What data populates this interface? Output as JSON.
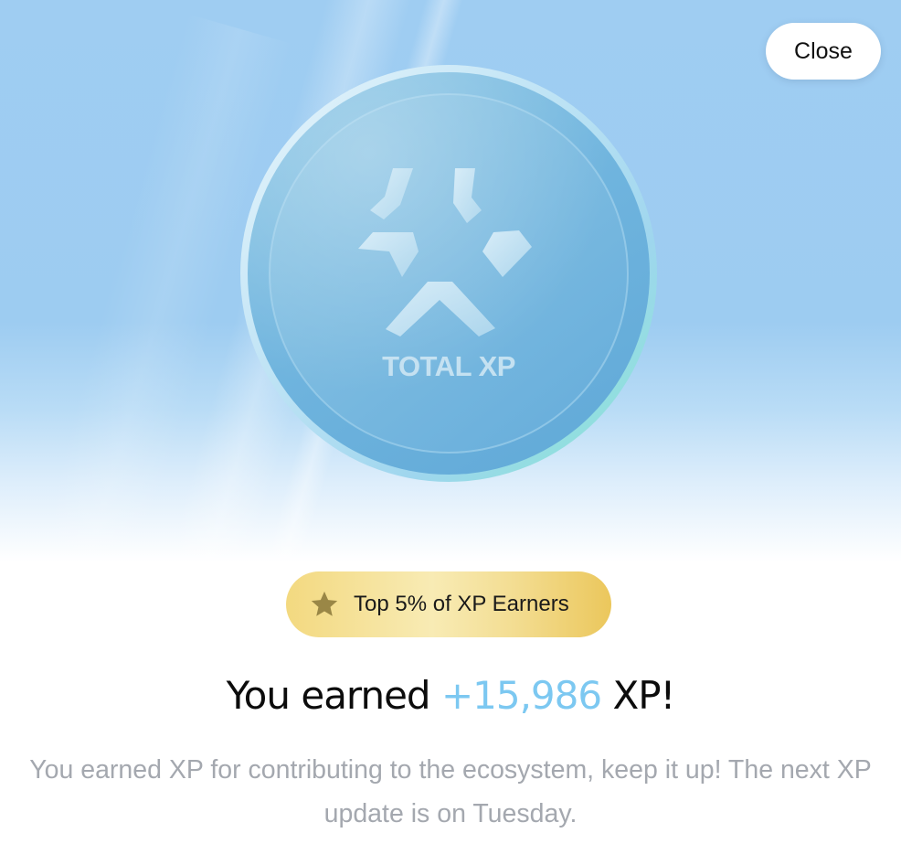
{
  "header": {
    "close_label": "Close"
  },
  "coin": {
    "label": "TOTAL XP",
    "icon": "xp-logo-icon"
  },
  "badge": {
    "icon": "star-icon",
    "label": "Top 5% of XP Earners"
  },
  "headline": {
    "prefix": "You earned ",
    "amount": "+15,986",
    "suffix": " XP!"
  },
  "description": {
    "text": "You earned XP for contributing to the ecosystem, keep it up! The next XP update is on Tuesday."
  },
  "colors": {
    "accent": "#7cc8f1",
    "hero_background": "#9fcdf2",
    "badge_gold": "#f3d980",
    "body_text": "#a4a8af"
  }
}
